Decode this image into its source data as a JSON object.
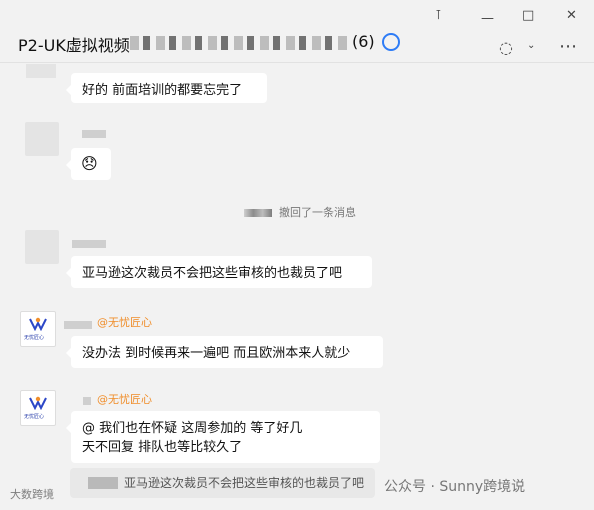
{
  "header": {
    "title": "P2-UK虚拟视频",
    "member_count": "(6)",
    "window_controls": [
      "pin-icon",
      "minimize-icon",
      "maximize-icon",
      "close-icon"
    ]
  },
  "messages": [
    {
      "type": "text",
      "text": "好的 前面培训的都要忘完了"
    },
    {
      "type": "emoji",
      "text": "😞"
    },
    {
      "type": "recall",
      "text": "撤回了一条消息"
    },
    {
      "type": "text",
      "text": "亚马逊这次裁员不会把这些审核的也裁员了吧"
    },
    {
      "type": "text",
      "sender_tag": "@无忧匠心",
      "text": "没办法 到时候再来一遍吧 而且欧洲本来人就少"
    },
    {
      "type": "text",
      "sender_tag": "@无忧匠心",
      "text_line_1": "@       我们也在怀疑 这周参加的 等了好几",
      "text_line_2": "天不回复 排队也等比较久了"
    }
  ],
  "quote": {
    "text": "亚马逊这次裁员不会把这些审核的也裁员了吧"
  },
  "watermark": {
    "left": "大数跨境",
    "right": "公众号 · Sunny跨境说"
  },
  "avatar_logo": {
    "text": "无忧匠心"
  }
}
